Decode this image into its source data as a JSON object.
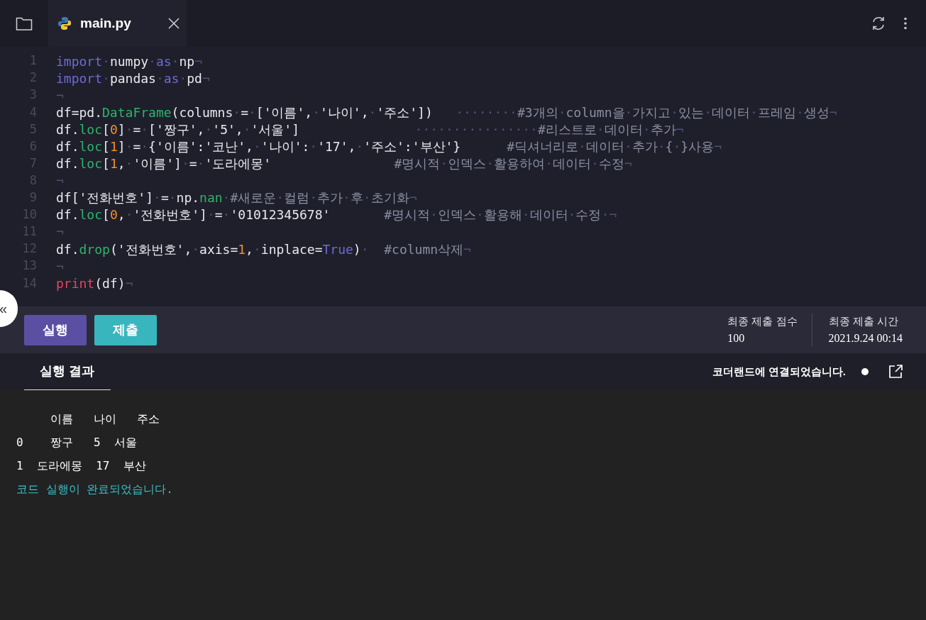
{
  "tabs": [
    {
      "label": "main.py",
      "selected": true
    }
  ],
  "code_lines": [
    {
      "number": "1",
      "tokens": [
        {
          "kind": "kw",
          "text": "import"
        },
        {
          "kind": "ws",
          "text": "·"
        },
        {
          "kind": "plain",
          "text": "numpy"
        },
        {
          "kind": "ws",
          "text": "·"
        },
        {
          "kind": "kw",
          "text": "as"
        },
        {
          "kind": "ws",
          "text": "·"
        },
        {
          "kind": "plain",
          "text": "np"
        },
        {
          "kind": "ws",
          "text": "¬"
        }
      ]
    },
    {
      "number": "2",
      "tokens": [
        {
          "kind": "kw",
          "text": "import"
        },
        {
          "kind": "ws",
          "text": "·"
        },
        {
          "kind": "plain",
          "text": "pandas"
        },
        {
          "kind": "ws",
          "text": "·"
        },
        {
          "kind": "kw",
          "text": "as"
        },
        {
          "kind": "ws",
          "text": "·"
        },
        {
          "kind": "plain",
          "text": "pd"
        },
        {
          "kind": "ws",
          "text": "¬"
        }
      ]
    },
    {
      "number": "3",
      "tokens": [
        {
          "kind": "ws",
          "text": "¬"
        }
      ]
    },
    {
      "number": "4",
      "tokens": [
        {
          "kind": "plain",
          "text": "df=pd."
        },
        {
          "kind": "fn",
          "text": "DataFrame"
        },
        {
          "kind": "plain",
          "text": "(columns"
        },
        {
          "kind": "ws",
          "text": "·"
        },
        {
          "kind": "plain",
          "text": "="
        },
        {
          "kind": "ws",
          "text": "·"
        },
        {
          "kind": "plain",
          "text": "['이름',"
        },
        {
          "kind": "ws",
          "text": "·"
        },
        {
          "kind": "plain",
          "text": "'나이',"
        },
        {
          "kind": "ws",
          "text": "·"
        },
        {
          "kind": "plain",
          "text": "'주소'])"
        },
        {
          "kind": "ws",
          "text": "   ········"
        },
        {
          "kind": "cmt",
          "text": "#3개의"
        },
        {
          "kind": "ws",
          "text": "·"
        },
        {
          "kind": "cmt",
          "text": "column을"
        },
        {
          "kind": "ws",
          "text": "·"
        },
        {
          "kind": "cmt",
          "text": "가지고"
        },
        {
          "kind": "ws",
          "text": "·"
        },
        {
          "kind": "cmt",
          "text": "있는"
        },
        {
          "kind": "ws",
          "text": "·"
        },
        {
          "kind": "cmt",
          "text": "데이터"
        },
        {
          "kind": "ws",
          "text": "·"
        },
        {
          "kind": "cmt",
          "text": "프레임"
        },
        {
          "kind": "ws",
          "text": "·"
        },
        {
          "kind": "cmt",
          "text": "생성"
        },
        {
          "kind": "ws",
          "text": "¬"
        }
      ]
    },
    {
      "number": "5",
      "tokens": [
        {
          "kind": "plain",
          "text": "df."
        },
        {
          "kind": "fn",
          "text": "loc"
        },
        {
          "kind": "plain",
          "text": "["
        },
        {
          "kind": "num",
          "text": "0"
        },
        {
          "kind": "plain",
          "text": "]"
        },
        {
          "kind": "ws",
          "text": "·"
        },
        {
          "kind": "plain",
          "text": "="
        },
        {
          "kind": "ws",
          "text": "·"
        },
        {
          "kind": "plain",
          "text": "['짱구',"
        },
        {
          "kind": "ws",
          "text": "·"
        },
        {
          "kind": "plain",
          "text": "'5',"
        },
        {
          "kind": "ws",
          "text": "·"
        },
        {
          "kind": "plain",
          "text": "'서울']"
        },
        {
          "kind": "ws",
          "text": "               ················"
        },
        {
          "kind": "cmt",
          "text": "#리스트로"
        },
        {
          "kind": "ws",
          "text": "·"
        },
        {
          "kind": "cmt",
          "text": "데이터"
        },
        {
          "kind": "ws",
          "text": "·"
        },
        {
          "kind": "cmt",
          "text": "추가"
        },
        {
          "kind": "ws",
          "text": "¬"
        }
      ]
    },
    {
      "number": "6",
      "tokens": [
        {
          "kind": "plain",
          "text": "df."
        },
        {
          "kind": "fn",
          "text": "loc"
        },
        {
          "kind": "plain",
          "text": "["
        },
        {
          "kind": "num",
          "text": "1"
        },
        {
          "kind": "plain",
          "text": "]"
        },
        {
          "kind": "ws",
          "text": "·"
        },
        {
          "kind": "plain",
          "text": "="
        },
        {
          "kind": "ws",
          "text": "·"
        },
        {
          "kind": "plain",
          "text": "{'이름':'코난',"
        },
        {
          "kind": "ws",
          "text": "·"
        },
        {
          "kind": "plain",
          "text": "'나이':"
        },
        {
          "kind": "ws",
          "text": "·"
        },
        {
          "kind": "plain",
          "text": "'17',"
        },
        {
          "kind": "ws",
          "text": "·"
        },
        {
          "kind": "plain",
          "text": "'주소':'부산'}"
        },
        {
          "kind": "cmt",
          "text": "      #딕셔너리로"
        },
        {
          "kind": "ws",
          "text": "·"
        },
        {
          "kind": "cmt",
          "text": "데이터"
        },
        {
          "kind": "ws",
          "text": "·"
        },
        {
          "kind": "cmt",
          "text": "추가"
        },
        {
          "kind": "ws",
          "text": "·"
        },
        {
          "kind": "cmt",
          "text": "{"
        },
        {
          "kind": "ws",
          "text": "·"
        },
        {
          "kind": "cmt",
          "text": "}사용"
        },
        {
          "kind": "ws",
          "text": "¬"
        }
      ]
    },
    {
      "number": "7",
      "tokens": [
        {
          "kind": "plain",
          "text": "df."
        },
        {
          "kind": "fn",
          "text": "loc"
        },
        {
          "kind": "plain",
          "text": "["
        },
        {
          "kind": "num",
          "text": "1"
        },
        {
          "kind": "plain",
          "text": ","
        },
        {
          "kind": "ws",
          "text": "·"
        },
        {
          "kind": "plain",
          "text": "'이름']"
        },
        {
          "kind": "ws",
          "text": "·"
        },
        {
          "kind": "plain",
          "text": "="
        },
        {
          "kind": "ws",
          "text": "·"
        },
        {
          "kind": "plain",
          "text": "'도라에몽'"
        },
        {
          "kind": "cmt",
          "text": "                #명시적"
        },
        {
          "kind": "ws",
          "text": "·"
        },
        {
          "kind": "cmt",
          "text": "인덱스"
        },
        {
          "kind": "ws",
          "text": "·"
        },
        {
          "kind": "cmt",
          "text": "활용하여"
        },
        {
          "kind": "ws",
          "text": "·"
        },
        {
          "kind": "cmt",
          "text": "데이터"
        },
        {
          "kind": "ws",
          "text": "·"
        },
        {
          "kind": "cmt",
          "text": "수정"
        },
        {
          "kind": "ws",
          "text": "¬"
        }
      ]
    },
    {
      "number": "8",
      "tokens": [
        {
          "kind": "ws",
          "text": "¬"
        }
      ]
    },
    {
      "number": "9",
      "tokens": [
        {
          "kind": "plain",
          "text": "df['전화번호']"
        },
        {
          "kind": "ws",
          "text": "·"
        },
        {
          "kind": "plain",
          "text": "="
        },
        {
          "kind": "ws",
          "text": "·"
        },
        {
          "kind": "plain",
          "text": "np."
        },
        {
          "kind": "fn",
          "text": "nan"
        },
        {
          "kind": "ws",
          "text": "·"
        },
        {
          "kind": "cmt",
          "text": "#새로운"
        },
        {
          "kind": "ws",
          "text": "·"
        },
        {
          "kind": "cmt",
          "text": "컬럼"
        },
        {
          "kind": "ws",
          "text": "·"
        },
        {
          "kind": "cmt",
          "text": "추가"
        },
        {
          "kind": "ws",
          "text": "·"
        },
        {
          "kind": "cmt",
          "text": "후"
        },
        {
          "kind": "ws",
          "text": "·"
        },
        {
          "kind": "cmt",
          "text": "초기화"
        },
        {
          "kind": "ws",
          "text": "¬"
        }
      ]
    },
    {
      "number": "10",
      "tokens": [
        {
          "kind": "plain",
          "text": "df."
        },
        {
          "kind": "fn",
          "text": "loc"
        },
        {
          "kind": "plain",
          "text": "["
        },
        {
          "kind": "num",
          "text": "0"
        },
        {
          "kind": "plain",
          "text": ","
        },
        {
          "kind": "ws",
          "text": "·"
        },
        {
          "kind": "plain",
          "text": "'전화번호']"
        },
        {
          "kind": "ws",
          "text": "·"
        },
        {
          "kind": "plain",
          "text": "="
        },
        {
          "kind": "ws",
          "text": "·"
        },
        {
          "kind": "plain",
          "text": "'01012345678'"
        },
        {
          "kind": "cmt",
          "text": "       #명시적"
        },
        {
          "kind": "ws",
          "text": "·"
        },
        {
          "kind": "cmt",
          "text": "인덱스"
        },
        {
          "kind": "ws",
          "text": "·"
        },
        {
          "kind": "cmt",
          "text": "활용해"
        },
        {
          "kind": "ws",
          "text": "·"
        },
        {
          "kind": "cmt",
          "text": "데이터"
        },
        {
          "kind": "ws",
          "text": "·"
        },
        {
          "kind": "cmt",
          "text": "수정"
        },
        {
          "kind": "ws",
          "text": "·¬"
        }
      ]
    },
    {
      "number": "11",
      "tokens": [
        {
          "kind": "ws",
          "text": "¬"
        }
      ]
    },
    {
      "number": "12",
      "tokens": [
        {
          "kind": "plain",
          "text": "df."
        },
        {
          "kind": "fn",
          "text": "drop"
        },
        {
          "kind": "plain",
          "text": "('전화번호',"
        },
        {
          "kind": "ws",
          "text": "·"
        },
        {
          "kind": "plain",
          "text": "axis="
        },
        {
          "kind": "num",
          "text": "1"
        },
        {
          "kind": "plain",
          "text": ","
        },
        {
          "kind": "ws",
          "text": "·"
        },
        {
          "kind": "plain",
          "text": "inplace="
        },
        {
          "kind": "kw",
          "text": "True"
        },
        {
          "kind": "plain",
          "text": ")"
        },
        {
          "kind": "ws",
          "text": "·"
        },
        {
          "kind": "cmt",
          "text": "  #column삭제"
        },
        {
          "kind": "ws",
          "text": "¬"
        }
      ]
    },
    {
      "number": "13",
      "tokens": [
        {
          "kind": "ws",
          "text": "¬"
        }
      ]
    },
    {
      "number": "14",
      "tokens": [
        {
          "kind": "builtin",
          "text": "print"
        },
        {
          "kind": "plain",
          "text": "(df)"
        },
        {
          "kind": "ws",
          "text": "¬"
        }
      ]
    }
  ],
  "collapse_button": "«",
  "buttons": [
    {
      "label": "실행",
      "kind": "run"
    },
    {
      "label": "제출",
      "kind": "submit"
    }
  ],
  "stats": [
    {
      "label": "최종 제출 점수",
      "value": "100"
    },
    {
      "label": "최종 제출 시간",
      "value": "2021.9.24 00:14"
    }
  ],
  "result_tabs": [
    {
      "label": "실행 결과",
      "selected": true
    }
  ],
  "connection_status": "코더랜드에 연결되었습니다.",
  "output_lines": [
    {
      "text": "     이름   나이   주소",
      "kind": "table"
    },
    {
      "text": "0    짱구   5  서울",
      "kind": "table"
    },
    {
      "text": "1  도라에몽  17  부산",
      "kind": "table"
    },
    {
      "text": "코드 실행이 완료되었습니다.",
      "kind": "status"
    }
  ]
}
